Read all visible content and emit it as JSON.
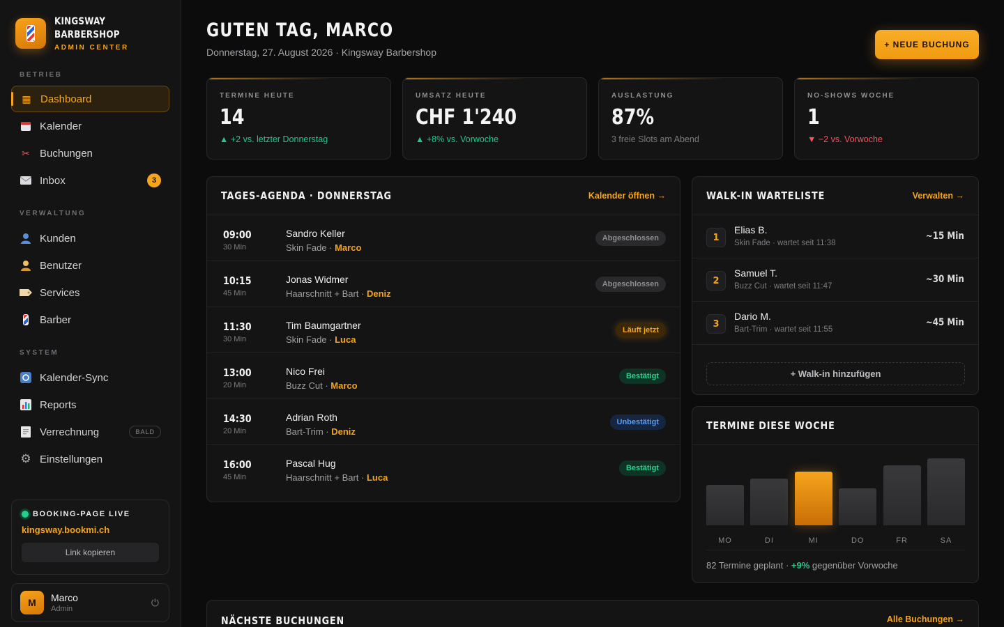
{
  "brand": {
    "line1": "KINGSWAY",
    "line2": "BARBERSHOP",
    "sub": "ADMIN CENTER"
  },
  "nav": {
    "sections": {
      "betrieb": "BETRIEB",
      "verwaltung": "VERWALTUNG",
      "system": "SYSTEM"
    },
    "items": [
      {
        "label": "Dashboard",
        "icon": "grid-icon"
      },
      {
        "label": "Kalender",
        "icon": "calendar-icon"
      },
      {
        "label": "Buchungen",
        "icon": "scissors-icon"
      },
      {
        "label": "Inbox",
        "icon": "mail-icon",
        "badge": "3"
      },
      {
        "label": "Kunden",
        "icon": "user-icon"
      },
      {
        "label": "Benutzer",
        "icon": "staff-icon"
      },
      {
        "label": "Services",
        "icon": "tag-icon"
      },
      {
        "label": "Barber",
        "icon": "barber-pole-icon"
      },
      {
        "label": "Kalender-Sync",
        "icon": "sync-icon"
      },
      {
        "label": "Reports",
        "icon": "chart-icon"
      },
      {
        "label": "Verrechnung",
        "icon": "receipt-icon",
        "tag": "BALD"
      },
      {
        "label": "Einstellungen",
        "icon": "gear-icon"
      }
    ]
  },
  "live": {
    "title": "BOOKING-PAGE LIVE",
    "url": "kingsway.bookmi.ch",
    "button": "Link kopieren"
  },
  "user": {
    "initial": "M",
    "name": "Marco",
    "role": "Admin"
  },
  "header": {
    "title": "GUTEN TAG, MARCO",
    "subtitle": "Donnerstag, 27. August 2026 · Kingsway Barbershop",
    "new_booking": "+ NEUE BUCHUNG"
  },
  "kpis": [
    {
      "label": "TERMINE HEUTE",
      "value": "14",
      "note": "▲ +2 vs. letzter Donnerstag",
      "trend": "up"
    },
    {
      "label": "UMSATZ HEUTE",
      "value": "CHF 1'240",
      "note": "▲ +8% vs. Vorwoche",
      "trend": "up"
    },
    {
      "label": "AUSLASTUNG",
      "value": "87%",
      "note": "3 freie Slots am Abend",
      "trend": "neutral"
    },
    {
      "label": "NO-SHOWS WOCHE",
      "value": "1",
      "note": "▼ −2 vs. Vorwoche",
      "trend": "down"
    }
  ],
  "agenda": {
    "title": "TAGES-AGENDA · DONNERSTAG",
    "link": "Kalender öffnen →",
    "rows": [
      {
        "time": "09:00",
        "duration": "30 Min",
        "client": "Sandro Keller",
        "service": "Skin Fade · ",
        "barber": "Marco",
        "status": "Abgeschlossen",
        "kind": "done"
      },
      {
        "time": "10:15",
        "duration": "45 Min",
        "client": "Jonas Widmer",
        "service": "Haarschnitt + Bart · ",
        "barber": "Deniz",
        "status": "Abgeschlossen",
        "kind": "done"
      },
      {
        "time": "11:30",
        "duration": "30 Min",
        "client": "Tim Baumgartner",
        "service": "Skin Fade · ",
        "barber": "Luca",
        "status": "Läuft jetzt",
        "kind": "live"
      },
      {
        "time": "13:00",
        "duration": "20 Min",
        "client": "Nico Frei",
        "service": "Buzz Cut · ",
        "barber": "Marco",
        "status": "Bestätigt",
        "kind": "ok"
      },
      {
        "time": "14:30",
        "duration": "20 Min",
        "client": "Adrian Roth",
        "service": "Bart-Trim · ",
        "barber": "Deniz",
        "status": "Unbestätigt",
        "kind": "unc"
      },
      {
        "time": "16:00",
        "duration": "45 Min",
        "client": "Pascal Hug",
        "service": "Haarschnitt + Bart · ",
        "barber": "Luca",
        "status": "Bestätigt",
        "kind": "ok"
      }
    ]
  },
  "waitlist": {
    "title": "WALK-IN WARTELISTE",
    "link": "Verwalten →",
    "rows": [
      {
        "num": "1",
        "name": "Elias B.",
        "sub": "Skin Fade · wartet seit 11:38",
        "eta": "~15 Min"
      },
      {
        "num": "2",
        "name": "Samuel T.",
        "sub": "Buzz Cut · wartet seit 11:47",
        "eta": "~30 Min"
      },
      {
        "num": "3",
        "name": "Dario M.",
        "sub": "Bart-Trim · wartet seit 11:55",
        "eta": "~45 Min"
      }
    ],
    "add": "+ Walk-in hinzufügen"
  },
  "week": {
    "title": "TERMINE DIESE WOCHE",
    "foot_pre": "82 Termine geplant · ",
    "foot_hl": "+9%",
    "foot_post": " gegenüber Vorwoche"
  },
  "chart_data": {
    "type": "bar",
    "categories": [
      "MO",
      "DI",
      "MI",
      "DO",
      "FR",
      "SA"
    ],
    "values": [
      12,
      14,
      16,
      11,
      18,
      20
    ],
    "highlight": "MI",
    "accent": "#f5a41c"
  },
  "next": {
    "title": "NÄCHSTE BUCHUNGEN",
    "link": "Alle Buchungen →"
  },
  "colors": {
    "accent": "#f5a41c",
    "success": "#23c98a",
    "danger": "#f2545b",
    "info": "#5a9cf0"
  }
}
